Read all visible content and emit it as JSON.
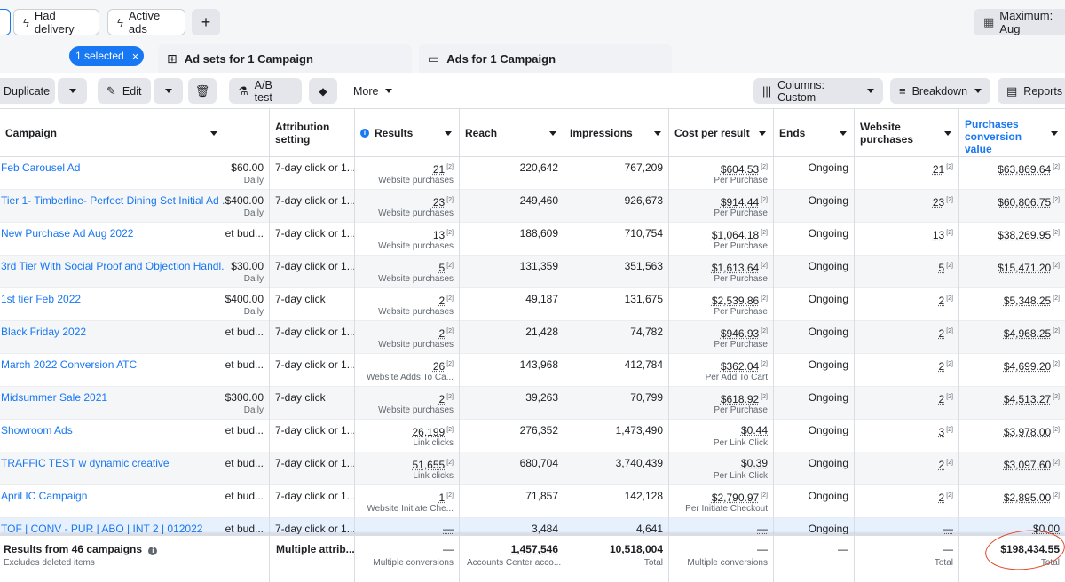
{
  "filters": {
    "had_delivery": "Had delivery",
    "active_ads": "Active ads",
    "add": "+",
    "date_range": "Maximum: Aug"
  },
  "selection": {
    "badge": "1 selected",
    "clear": "×"
  },
  "tabs": [
    {
      "label": "Ad sets for 1 Campaign",
      "icon": "ad-sets-grid-icon"
    },
    {
      "label": "Ads for 1 Campaign",
      "icon": "ads-window-icon"
    }
  ],
  "toolbar": {
    "duplicate": "Duplicate",
    "edit": "Edit",
    "ab_test": "A/B test",
    "more": "More",
    "columns": "Columns: Custom",
    "breakdown": "Breakdown",
    "reports": "Reports"
  },
  "headers": {
    "campaign": "Campaign",
    "attribution": "Attribution setting",
    "results": "Results",
    "reach": "Reach",
    "impressions": "Impressions",
    "cost": "Cost per result",
    "ends": "Ends",
    "website_purchases": "Website purchases",
    "pcv": "Purchases conversion value",
    "sort_arrow": "↓"
  },
  "rows": [
    {
      "name": "Feb Carousel Ad",
      "budget": "$60.00",
      "budget_sub": "Daily",
      "attribution": "7-day click or 1...",
      "results": "21",
      "results_sub": "Website purchases",
      "reach": "220,642",
      "impressions": "767,209",
      "cost": "$604.53",
      "cost_sub": "Per Purchase",
      "ends": "Ongoing",
      "wp": "21",
      "pcv": "$63,869.64"
    },
    {
      "name": "Tier 1- Timberline- Perfect Dining Set Initial Ad ...",
      "budget": "$400.00",
      "budget_sub": "Daily",
      "attribution": "7-day click or 1...",
      "results": "23",
      "results_sub": "Website purchases",
      "reach": "249,460",
      "impressions": "926,673",
      "cost": "$914.44",
      "cost_sub": "Per Purchase",
      "ends": "Ongoing",
      "wp": "23",
      "pcv": "$60,806.75"
    },
    {
      "name": "New Purchase Ad Aug 2022",
      "budget": "et bud...",
      "budget_sub": "",
      "attribution": "7-day click or 1...",
      "results": "13",
      "results_sub": "Website purchases",
      "reach": "188,609",
      "impressions": "710,754",
      "cost": "$1,064.18",
      "cost_sub": "Per Purchase",
      "ends": "Ongoing",
      "wp": "13",
      "pcv": "$38,269.95"
    },
    {
      "name": "3rd Tier With Social Proof and Objection Handl...",
      "budget": "$30.00",
      "budget_sub": "Daily",
      "attribution": "7-day click or 1...",
      "results": "5",
      "results_sub": "Website purchases",
      "reach": "131,359",
      "impressions": "351,563",
      "cost": "$1,613.64",
      "cost_sub": "Per Purchase",
      "ends": "Ongoing",
      "wp": "5",
      "pcv": "$15,471.20"
    },
    {
      "name": "1st tier Feb 2022",
      "budget": "$400.00",
      "budget_sub": "Daily",
      "attribution": "7-day click",
      "results": "2",
      "results_sub": "Website purchases",
      "reach": "49,187",
      "impressions": "131,675",
      "cost": "$2,539.86",
      "cost_sub": "Per Purchase",
      "ends": "Ongoing",
      "wp": "2",
      "pcv": "$5,348.25"
    },
    {
      "name": "Black Friday 2022",
      "budget": "et bud...",
      "budget_sub": "",
      "attribution": "7-day click or 1...",
      "results": "2",
      "results_sub": "Website purchases",
      "reach": "21,428",
      "impressions": "74,782",
      "cost": "$946.93",
      "cost_sub": "Per Purchase",
      "ends": "Ongoing",
      "wp": "2",
      "pcv": "$4,968.25"
    },
    {
      "name": "March 2022 Conversion ATC",
      "budget": "et bud...",
      "budget_sub": "",
      "attribution": "7-day click or 1...",
      "results": "26",
      "results_sub": "Website Adds To Ca...",
      "reach": "143,968",
      "impressions": "412,784",
      "cost": "$362.04",
      "cost_sub": "Per Add To Cart",
      "ends": "Ongoing",
      "wp": "2",
      "pcv": "$4,699.20"
    },
    {
      "name": "Midsummer Sale 2021",
      "budget": "$300.00",
      "budget_sub": "Daily",
      "attribution": "7-day click",
      "results": "2",
      "results_sub": "Website purchases",
      "reach": "39,263",
      "impressions": "70,799",
      "cost": "$618.92",
      "cost_sub": "Per Purchase",
      "ends": "Ongoing",
      "wp": "2",
      "pcv": "$4,513.27"
    },
    {
      "name": "Showroom Ads",
      "budget": "et bud...",
      "budget_sub": "",
      "attribution": "7-day click or 1...",
      "results": "26,199",
      "results_sub": "Link clicks",
      "reach": "276,352",
      "impressions": "1,473,490",
      "cost": "$0.44",
      "cost_sub": "Per Link Click",
      "ends": "Ongoing",
      "wp": "3",
      "pcv": "$3,978.00"
    },
    {
      "name": "TRAFFIC TEST w dynamic creative",
      "budget": "et bud...",
      "budget_sub": "",
      "attribution": "7-day click or 1...",
      "results": "51,655",
      "results_sub": "Link clicks",
      "reach": "680,704",
      "impressions": "3,740,439",
      "cost": "$0.39",
      "cost_sub": "Per Link Click",
      "ends": "Ongoing",
      "wp": "2",
      "pcv": "$3,097.60"
    },
    {
      "name": "April IC Campaign",
      "budget": "et bud...",
      "budget_sub": "",
      "attribution": "7-day click or 1...",
      "results": "1",
      "results_sub": "Website Initiate Che...",
      "reach": "71,857",
      "impressions": "142,128",
      "cost": "$2,790.97",
      "cost_sub": "Per Initiate Checkout",
      "ends": "Ongoing",
      "wp": "2",
      "pcv": "$2,895.00"
    },
    {
      "name": "TOF | CONV - PUR | ABO | INT 2 | 012022",
      "budget": "et bud...",
      "budget_sub": "",
      "attribution": "7-day click or 1...",
      "results": "—",
      "results_sub": "",
      "reach": "3,484",
      "impressions": "4,641",
      "cost": "—",
      "cost_sub": "",
      "ends": "Ongoing",
      "wp": "—",
      "pcv": "$0.00"
    }
  ],
  "totals": {
    "label": "Results from 46 campaigns",
    "label_sub": "Excludes deleted items",
    "attribution": "Multiple attrib...",
    "results": "—",
    "results_sub": "Multiple conversions",
    "reach": "1,457,546",
    "reach_sub": "Accounts Center acco...",
    "impressions": "10,518,004",
    "impressions_sub": "Total",
    "cost": "—",
    "cost_sub": "Multiple conversions",
    "ends": "—",
    "wp": "—",
    "wp_sub": "Total",
    "pcv": "$198,434.55",
    "pcv_sub": "Total"
  },
  "colors": {
    "accent": "#1877f2",
    "annotation_circle": "#e0452b"
  }
}
